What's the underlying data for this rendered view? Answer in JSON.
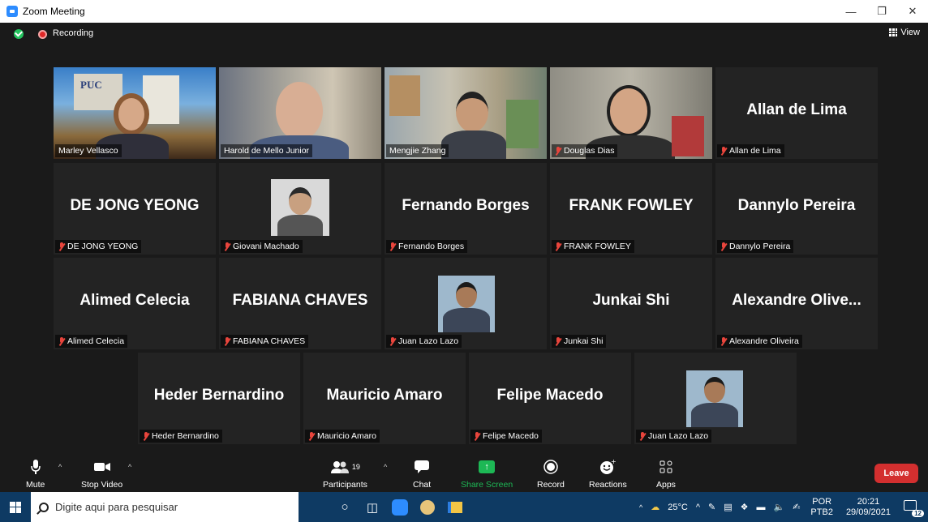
{
  "window": {
    "title": "Zoom Meeting"
  },
  "topbar": {
    "recording_label": "Recording",
    "view_label": "View"
  },
  "tiles": [
    {
      "name": "Marley Vellasco",
      "video": true,
      "muted": false,
      "active": true
    },
    {
      "name": "Harold de Mello Junior",
      "video": true,
      "muted": false
    },
    {
      "name": "Mengjie Zhang",
      "video": true,
      "muted": false
    },
    {
      "name": "Douglas Dias",
      "video": true,
      "muted": true
    },
    {
      "name": "Allan de Lima",
      "display": "Allan de Lima",
      "muted": true
    },
    {
      "name": "DE JONG YEONG",
      "display": "DE JONG YEONG",
      "muted": true
    },
    {
      "name": "Giovani Machado",
      "photo": true,
      "muted": true
    },
    {
      "name": "Fernando Borges",
      "display": "Fernando Borges",
      "muted": true
    },
    {
      "name": "FRANK FOWLEY",
      "display": "FRANK FOWLEY",
      "muted": true
    },
    {
      "name": "Dannylo Pereira",
      "display": "Dannylo Pereira",
      "muted": true
    },
    {
      "name": "Alimed Celecia",
      "display": "Alimed Celecia",
      "muted": true
    },
    {
      "name": "FABIANA CHAVES",
      "display": "FABIANA CHAVES",
      "muted": true
    },
    {
      "name": "Juan Lazo Lazo",
      "photo": true,
      "muted": true
    },
    {
      "name": "Junkai Shi",
      "display": "Junkai Shi",
      "muted": true
    },
    {
      "name": "Alexandre Oliveira",
      "display": "Alexandre  Olive...",
      "muted": true
    },
    {
      "name": "Heder Bernardino",
      "display": "Heder Bernardino",
      "muted": true
    },
    {
      "name": "Mauricio Amaro",
      "display": "Mauricio Amaro",
      "muted": true
    },
    {
      "name": "Felipe Macedo",
      "display": "Felipe Macedo",
      "muted": true
    },
    {
      "name": "Juan Lazo Lazo",
      "photo": true,
      "muted": true
    }
  ],
  "toolbar": {
    "mute": "Mute",
    "stop_video": "Stop Video",
    "participants": "Participants",
    "participants_count": "19",
    "chat": "Chat",
    "share_screen": "Share Screen",
    "record": "Record",
    "reactions": "Reactions",
    "apps": "Apps",
    "leave": "Leave"
  },
  "taskbar": {
    "search_placeholder": "Digite aqui para pesquisar",
    "temperature": "25°C",
    "lang_top": "POR",
    "lang_bottom": "PTB2",
    "time": "20:21",
    "date": "29/09/2021",
    "notifications": "12"
  },
  "colors": {
    "active_speaker_border": "#c8e04a",
    "leave": "#d32f2f",
    "share": "#1db855",
    "taskbar": "#0e3a63",
    "muted_icon": "#e8453c"
  }
}
